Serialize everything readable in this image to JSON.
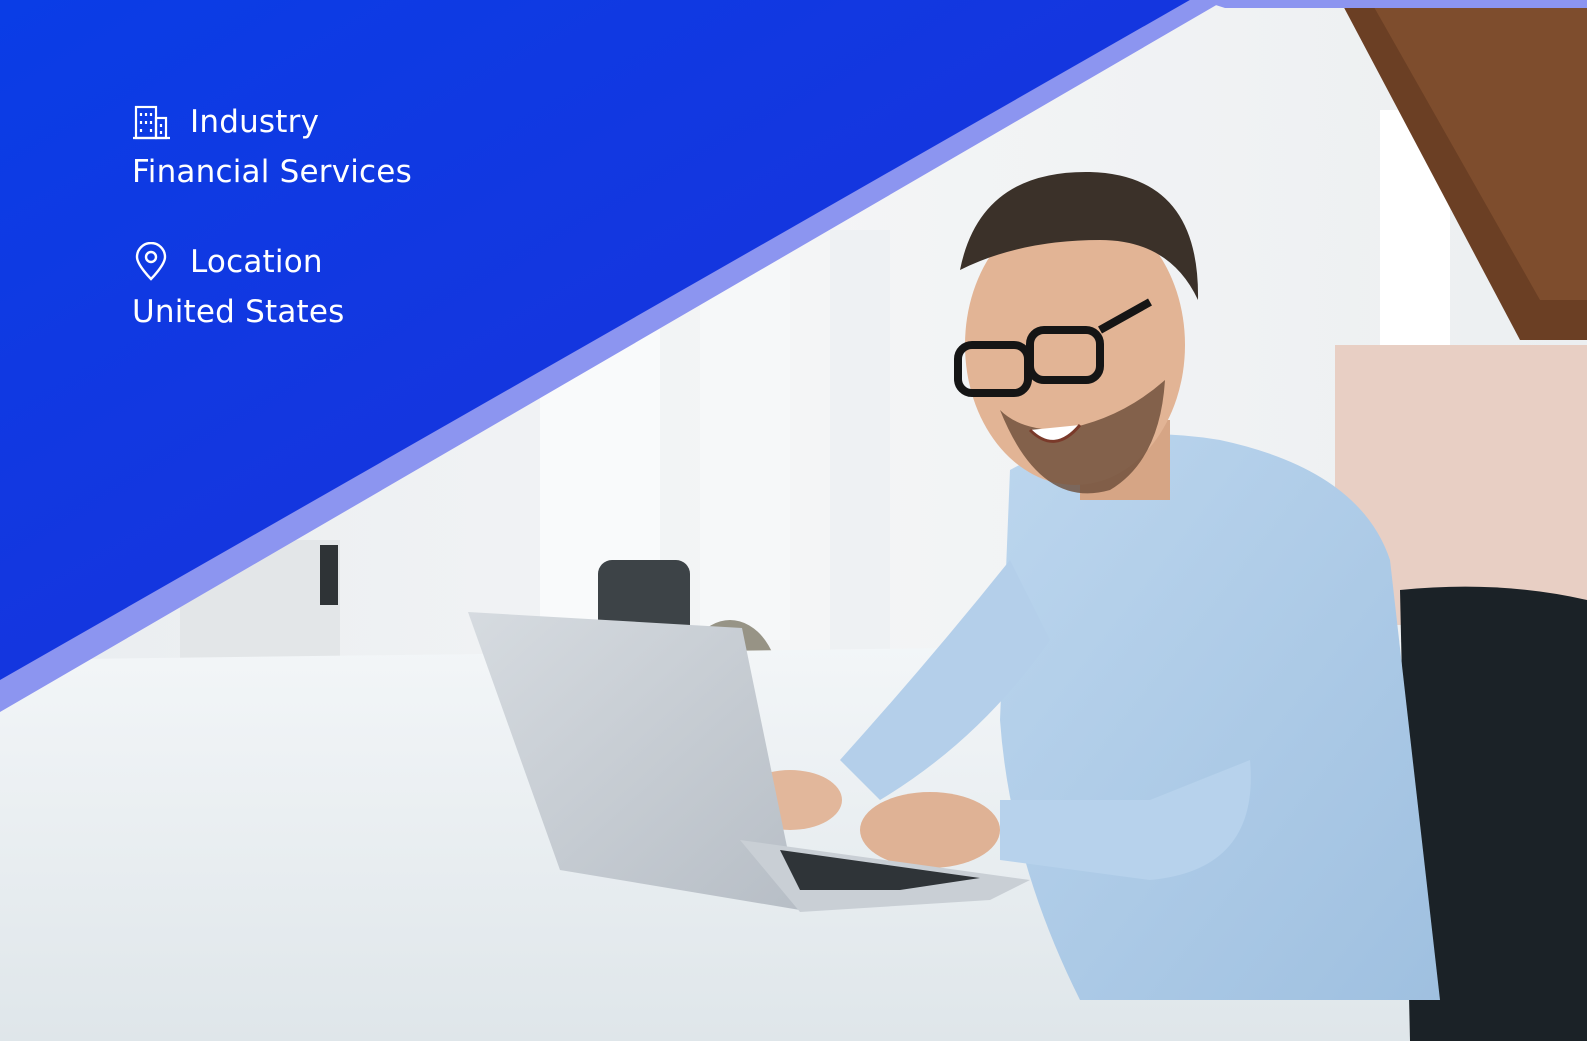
{
  "colors": {
    "overlay_start": "#0a3de6",
    "overlay_end": "#1f2fd8",
    "stripe": "#8c95f0",
    "text": "#ffffff"
  },
  "details": [
    {
      "icon": "building-icon",
      "label": "Industry",
      "value": "Financial Services"
    },
    {
      "icon": "location-pin-icon",
      "label": "Location",
      "value": "United States"
    }
  ]
}
